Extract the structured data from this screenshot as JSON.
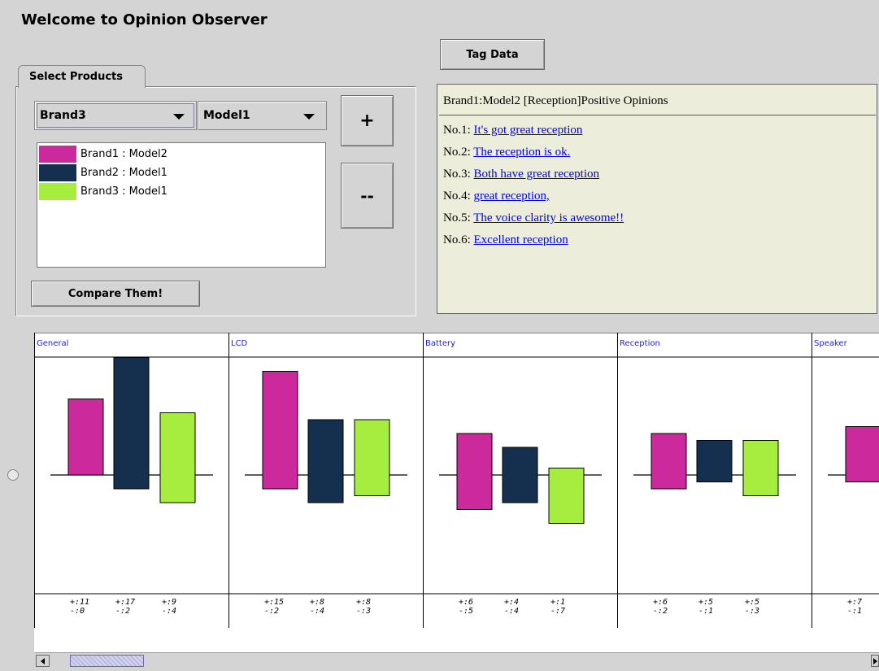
{
  "app": {
    "title": "Welcome to Opinion Observer"
  },
  "tabs": [
    {
      "label": "Select Products"
    }
  ],
  "selectors": {
    "brand": {
      "selected": "Brand3"
    },
    "model": {
      "selected": "Model1"
    }
  },
  "buttons": {
    "add": "+",
    "remove": "--",
    "compare": "Compare Them!",
    "tag_data": "Tag Data"
  },
  "products": [
    {
      "label": "Brand1 : Model2",
      "color": "#cc2a9c"
    },
    {
      "label": "Brand2 : Model1",
      "color": "#15304e"
    },
    {
      "label": "Brand3 : Model1",
      "color": "#a6ed3f"
    }
  ],
  "opinions": {
    "heading": "Brand1:Model2 [Reception]Positive Opinions",
    "items": [
      {
        "prefix": "No.1: ",
        "text": "It's got great reception "
      },
      {
        "prefix": "No.2: ",
        "text": "The reception is ok. "
      },
      {
        "prefix": "No.3: ",
        "text": "Both have great reception "
      },
      {
        "prefix": "No.4: ",
        "text": "great reception, "
      },
      {
        "prefix": "No.5: ",
        "text": "The voice clarity is awesome!! "
      },
      {
        "prefix": "No.6: ",
        "text": "Excellent reception "
      }
    ]
  },
  "chart_data": {
    "type": "bar",
    "categories": [
      "General",
      "LCD",
      "Battery",
      "Reception",
      "Speaker"
    ],
    "series_colors": [
      "#cc2a9c",
      "#15304e",
      "#a6ed3f"
    ],
    "series": [
      {
        "name": "Brand1 : Model2",
        "positive": [
          11,
          15,
          6,
          6,
          7
        ],
        "negative": [
          0,
          2,
          5,
          2,
          1
        ]
      },
      {
        "name": "Brand2 : Model1",
        "positive": [
          17,
          8,
          4,
          5,
          null
        ],
        "negative": [
          2,
          4,
          4,
          1,
          null
        ]
      },
      {
        "name": "Brand3 : Model1",
        "positive": [
          9,
          8,
          1,
          5,
          null
        ],
        "negative": [
          4,
          3,
          7,
          3,
          null
        ]
      }
    ],
    "count_labels": [
      [
        [
          "+:11",
          "-:0"
        ],
        [
          "+:17",
          "-:2"
        ],
        [
          "+:9",
          "-:4"
        ]
      ],
      [
        [
          "+:15",
          "-:2"
        ],
        [
          "+:8",
          "-:4"
        ],
        [
          "+:8",
          "-:3"
        ]
      ],
      [
        [
          "+:6",
          "-:5"
        ],
        [
          "+:4",
          "-:4"
        ],
        [
          "+:1",
          "-:7"
        ]
      ],
      [
        [
          "+:6",
          "-:2"
        ],
        [
          "+:5",
          "-:1"
        ],
        [
          "+:5",
          "-:3"
        ]
      ],
      [
        [
          "+:7",
          "-:1"
        ]
      ]
    ],
    "grid": false,
    "legend": "product list"
  }
}
